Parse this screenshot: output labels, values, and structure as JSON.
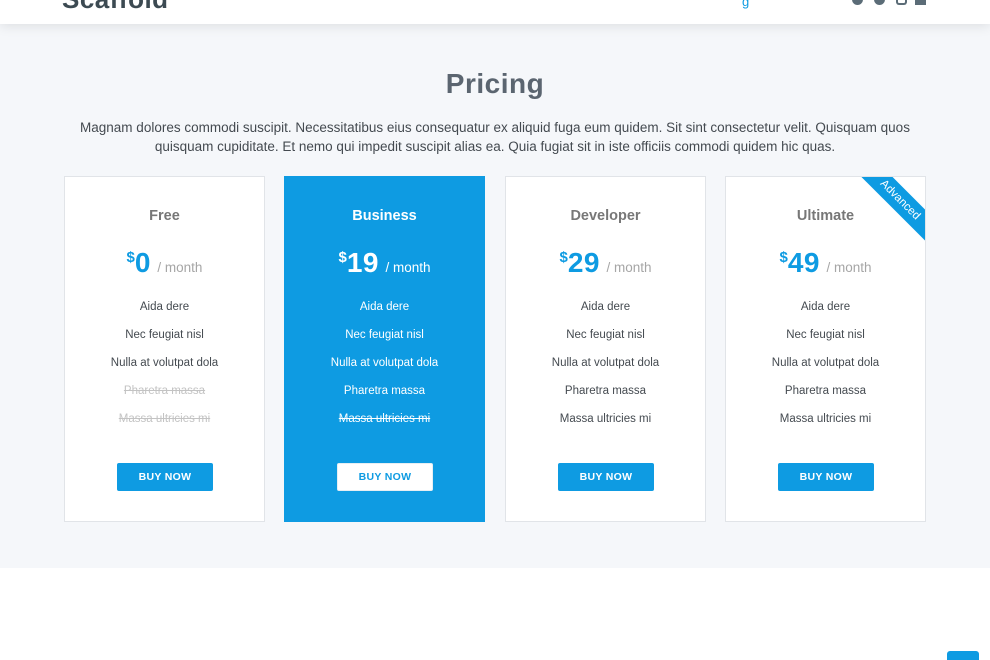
{
  "header": {
    "logo": "Scaffold",
    "nav_link": "g",
    "social_icons": [
      "twitter-icon",
      "facebook-icon",
      "instagram-icon",
      "linkedin-icon"
    ]
  },
  "pricing": {
    "title": "Pricing",
    "description": "Magnam dolores commodi suscipit. Necessitatibus eius consequatur ex aliquid fuga eum quidem. Sit sint consectetur velit. Quisquam quos quisquam cupiditate. Et nemo qui impedit suscipit alias ea. Quia fugiat sit in iste officiis commodi quidem hic quas.",
    "currency": "$",
    "period": "/ month",
    "plans": [
      {
        "name": "Free",
        "price": "0",
        "features": [
          {
            "label": "Aida dere",
            "included": true
          },
          {
            "label": "Nec feugiat nisl",
            "included": true
          },
          {
            "label": "Nulla at volutpat dola",
            "included": true
          },
          {
            "label": "Pharetra massa",
            "included": false
          },
          {
            "label": "Massa ultricies mi",
            "included": false
          }
        ],
        "button": "BUY NOW"
      },
      {
        "name": "Business",
        "price": "19",
        "featured": true,
        "features": [
          {
            "label": "Aida dere",
            "included": true
          },
          {
            "label": "Nec feugiat nisl",
            "included": true
          },
          {
            "label": "Nulla at volutpat dola",
            "included": true
          },
          {
            "label": "Pharetra massa",
            "included": true
          },
          {
            "label": "Massa ultricies mi",
            "included": false
          }
        ],
        "button": "BUY NOW"
      },
      {
        "name": "Developer",
        "price": "29",
        "features": [
          {
            "label": "Aida dere",
            "included": true
          },
          {
            "label": "Nec feugiat nisl",
            "included": true
          },
          {
            "label": "Nulla at volutpat dola",
            "included": true
          },
          {
            "label": "Pharetra massa",
            "included": true
          },
          {
            "label": "Massa ultricies mi",
            "included": true
          }
        ],
        "button": "BUY NOW"
      },
      {
        "name": "Ultimate",
        "price": "49",
        "ribbon": "Advanced",
        "features": [
          {
            "label": "Aida dere",
            "included": true
          },
          {
            "label": "Nec feugiat nisl",
            "included": true
          },
          {
            "label": "Nulla at volutpat dola",
            "included": true
          },
          {
            "label": "Pharetra massa",
            "included": true
          },
          {
            "label": "Massa ultricies mi",
            "included": true
          }
        ],
        "button": "BUY NOW"
      }
    ]
  },
  "colors": {
    "accent": "#0e9be2",
    "section_bg": "#f5f7fa",
    "muted_text": "#c3c3c3"
  }
}
